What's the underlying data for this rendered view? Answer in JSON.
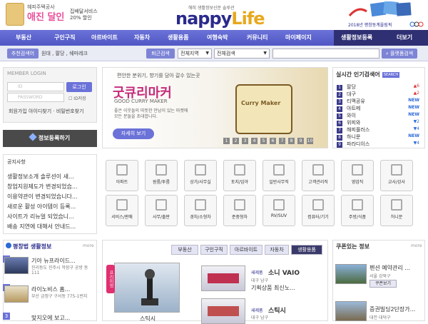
{
  "header": {
    "promo": {
      "tag": "혜피주택공사",
      "title": "애진 달인",
      "service_line1": "집배달서비스",
      "service_line2": "20% 할인"
    },
    "logo": {
      "subtitle": "해피 생활정보신문 솔루션",
      "main": "nappy",
      "accent": "Life"
    },
    "olympic": "2018년 평창동계올림픽"
  },
  "nav": {
    "items": [
      "부동산",
      "구인구직",
      "아르바이트",
      "자동차",
      "생활용품",
      "여행숙박",
      "커뮤니티",
      "마이페이지"
    ],
    "right": [
      "생활정보등록",
      "더보기"
    ]
  },
  "search": {
    "recommend_label": "추천검색어",
    "recommend_keywords": "원대 , 팔당 , 쉐마레크",
    "label": "퇴근검색",
    "region": "전체지역",
    "category": "전체검색",
    "button": "플랫폼검색"
  },
  "login": {
    "title": "MEMBER LOGIN",
    "id_placeholder": "ID",
    "pw_placeholder": "PASSWORD",
    "button": "로그인",
    "save_id": "ID저장",
    "links": "회원가입  아이디찾기 · 비밀번호찾기"
  },
  "register_button": "정보등록하기",
  "banner": {
    "tag": "편안한 분위기, 향기를 담아 갈수 있는곳",
    "title": "굿큐리마커",
    "en": "GOOD CURRY MAKER",
    "desc": "좋은 이웃들의 따뜻한 만남이 있는 마켓에 모든 분들을 초대합니다.",
    "button": "자세히 보기",
    "sign_text": "Curry Maker",
    "pages": [
      "1",
      "2",
      "3",
      "4",
      "5",
      "6",
      "7",
      "8",
      "9",
      "10"
    ]
  },
  "realtime": {
    "title": "실시간 인기검색어",
    "badge": "SEARCH",
    "items": [
      {
        "rank": "1",
        "word": "팔당",
        "change": "▲6",
        "dir": "up"
      },
      {
        "rank": "2",
        "word": "대구",
        "change": "▲2",
        "dir": "up"
      },
      {
        "rank": "3",
        "word": "티맥공유",
        "change": "NEW",
        "dir": "new"
      },
      {
        "rank": "4",
        "word": "아트메",
        "change": "NEW",
        "dir": "new"
      },
      {
        "rank": "5",
        "word": "와이",
        "change": "NEW",
        "dir": "new"
      },
      {
        "rank": "6",
        "word": "위피와",
        "change": "▼2",
        "dir": "down"
      },
      {
        "rank": "7",
        "word": "해피플러스",
        "change": "▼4",
        "dir": "down"
      },
      {
        "rank": "8",
        "word": "하니문",
        "change": "NEW",
        "dir": "new"
      },
      {
        "rank": "9",
        "word": "파라디이스",
        "change": "▼4",
        "dir": "down"
      }
    ]
  },
  "notice": {
    "title": "공지사항",
    "items": [
      "생활정보소개 솔루션이 새...",
      "창업지원제도가 변경되었습...",
      "이용약관이 변경되었습니다...",
      "새로운 활성 아이템이 등록...",
      "사이트가 리뉴얼 되었습니...",
      "배송 지연에 대해서 안내드..."
    ]
  },
  "categories": [
    "아파트",
    "원룸/투룸",
    "상가/사무실",
    "토지/임야",
    "일반사무직",
    "고객관리직",
    "영업직",
    "교사/강사",
    "서비스/판매",
    "사무/출판",
    "경차/소형차",
    "준중형차",
    "RV/SUV",
    "컴퓨터/기기",
    "주방/식품",
    "허니문"
  ],
  "housing": {
    "title": "평창법 생활정보",
    "more": "more",
    "items": [
      {
        "num": "1",
        "name": "기아 뉴프라이드...",
        "sub": "진리동도 진주시 막장구 공방 동 111"
      },
      {
        "num": "2",
        "name": "라이노비스 홈...",
        "sub": "부산 금정구 구서동 775-1번지"
      },
      {
        "num": "3",
        "name": "맞지오에 보고..."
      }
    ]
  },
  "content_tabs": {
    "items": [
      "부동산",
      "구인구직",
      "아르바이트",
      "자동차",
      "생활용품"
    ],
    "active": "생활용품",
    "feature_label": "프리미엄",
    "feature_name": "스틱시",
    "products": [
      {
        "tag": "새제품",
        "name": "소니 VAIO",
        "loc": "대구 남구",
        "desc": "기획상품 최신노..."
      },
      {
        "tag": "새제품",
        "name": "스틱시",
        "loc": "대구 남구",
        "desc": ""
      }
    ]
  },
  "coupon": {
    "title": "쿠폰있는 정보",
    "more": "more",
    "items": [
      {
        "name": "펜션 예약관리 ...",
        "loc": "서울 강북구",
        "button": "쿠폰보기"
      },
      {
        "name": "증권빌딩2단장가...",
        "loc": "대전 대덕구"
      }
    ]
  },
  "colors": {
    "nav": "#5c63cf",
    "accent": "#e94f9a",
    "dark": "#2f2f74"
  }
}
